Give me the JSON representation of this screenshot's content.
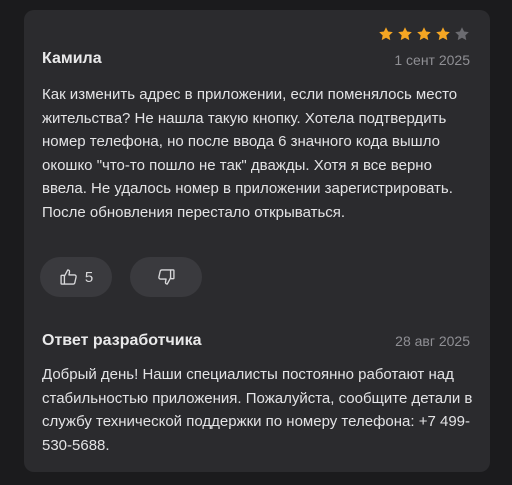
{
  "review": {
    "author": "Камила",
    "date": "1 сент 2025",
    "rating": 4,
    "rating_max": 5,
    "text": "Как изменить адрес в приложении, если поменялось место жительства?  Не нашла такую кнопку. Хотела подтвердить номер телефона, но после ввода 6 значного кода вышло окошко \"что-то пошло не так\" дважды. Хотя я все верно ввела. Не удалось номер в приложении зарегистрировать. После обновления перестало открываться.",
    "likes": "5"
  },
  "reply": {
    "title": "Ответ разработчика",
    "date": "28 авг 2025",
    "text": "Добрый день! Наши специалисты постоянно работают над стабильностью приложения. Пожалуйста, сообщите детали в службу технической поддержки по номеру телефона: +7 499-530-5688."
  },
  "colors": {
    "background": "#1b1b1d",
    "card": "#2b2b2e",
    "star_filled": "#f5a623",
    "star_empty": "#6b6b70",
    "button": "#3a3a3e"
  },
  "icons": {
    "like": "thumbs-up-icon",
    "dislike": "thumbs-down-icon",
    "star": "star-icon"
  }
}
